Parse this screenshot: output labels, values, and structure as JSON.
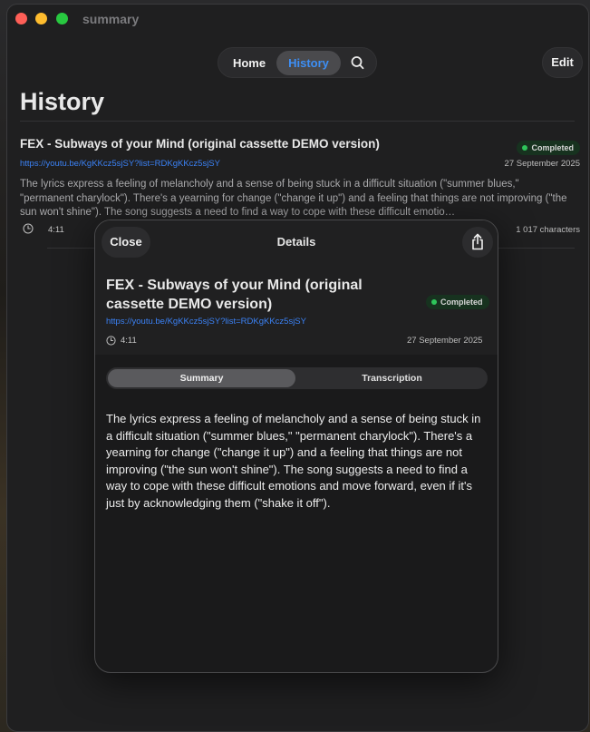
{
  "window": {
    "title": "summary"
  },
  "nav": {
    "home_label": "Home",
    "history_label": "History",
    "edit_label": "Edit"
  },
  "page": {
    "title": "History"
  },
  "item": {
    "title": "FEX - Subways of your Mind (original cassette DEMO version)",
    "status": "Completed",
    "url": "https://youtu.be/KgKKcz5sjSY?list=RDKgKKcz5sjSY",
    "date": "27 September 2025",
    "summary": "The lyrics express a feeling of melancholy and a sense of being stuck in a difficult situation (\"summer blues,\" \"permanent charylock\"). There's a yearning for change (\"change it up\") and a feeling that things are not improving (\"the sun won't shine\"). The song suggests a need to find a way to cope with these difficult emotio…",
    "duration": "4:11",
    "characters": "1 017 characters"
  },
  "details": {
    "close_label": "Close",
    "title": "Details",
    "song_title": "FEX - Subways of your Mind (original cassette DEMO version)",
    "status": "Completed",
    "url": "https://youtu.be/KgKKcz5sjSY?list=RDKgKKcz5sjSY",
    "duration": "4:11",
    "date": "27 September 2025",
    "tabs": {
      "summary": "Summary",
      "transcription": "Transcription"
    },
    "summary_text": "The lyrics express a feeling of melancholy and a sense of being stuck in a difficult situation (\"summer blues,\" \"permanent charylock\"). There's a yearning for change (\"change it up\") and a feeling that things are not improving (\"the sun won't shine\"). The song suggests a need to find a way to cope with these difficult emotions and move forward, even if it's just by acknowledging them (\"shake it off\")."
  },
  "colors": {
    "accent": "#3d8ff5",
    "link": "#3b82f6",
    "status_green": "#2ec55a"
  },
  "icons": {
    "search": "magnifying-glass",
    "clock": "clock",
    "share": "square-and-arrow-up"
  }
}
